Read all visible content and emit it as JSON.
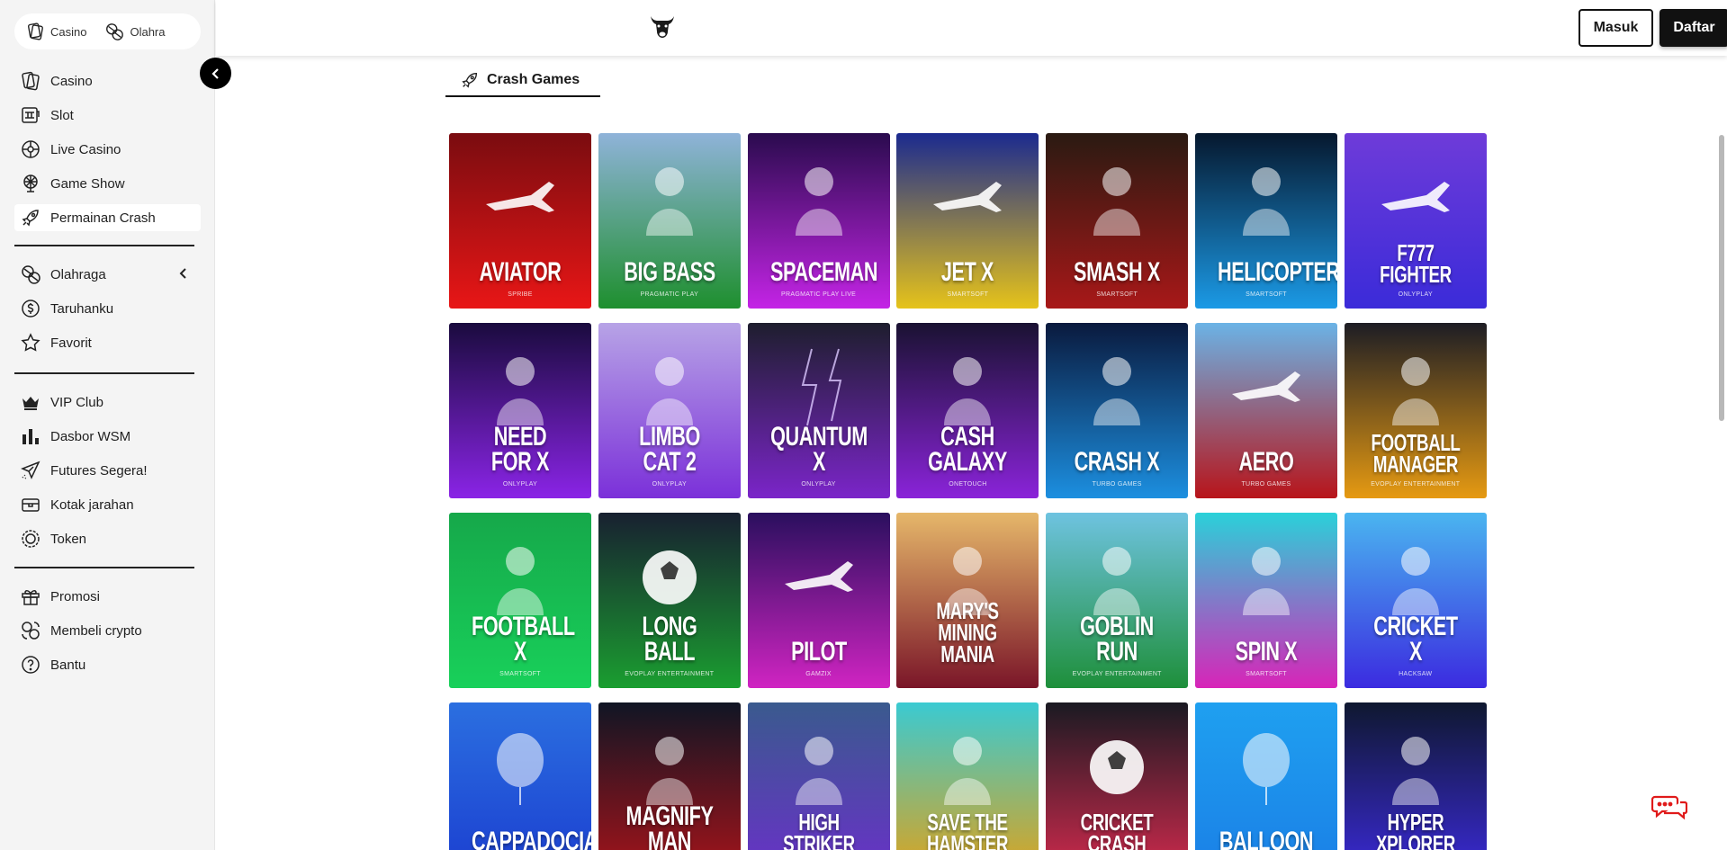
{
  "sidebar": {
    "switch": {
      "casino": "Casino",
      "sports": "Olahra"
    },
    "group1": [
      {
        "label": "Casino",
        "icon": "cards-icon"
      },
      {
        "label": "Slot",
        "icon": "slot-machine-icon"
      },
      {
        "label": "Live Casino",
        "icon": "roulette-icon"
      },
      {
        "label": "Game Show",
        "icon": "wheel-icon"
      },
      {
        "label": "Permainan Crash",
        "icon": "rocket-icon"
      }
    ],
    "group2": [
      {
        "label": "Olahraga",
        "icon": "balls-icon"
      },
      {
        "label": "Taruhanku",
        "icon": "coin-icon"
      },
      {
        "label": "Favorit",
        "icon": "star-icon"
      }
    ],
    "group3": [
      {
        "label": "VIP Club",
        "icon": "crown-icon"
      },
      {
        "label": "Dasbor WSM",
        "icon": "bar-chart-icon"
      },
      {
        "label": "Futures Segera!",
        "icon": "paper-plane-icon"
      },
      {
        "label": "Kotak jarahan",
        "icon": "chest-icon"
      },
      {
        "label": "Token",
        "icon": "token-icon"
      }
    ],
    "group4": [
      {
        "label": "Promosi",
        "icon": "gift-icon"
      },
      {
        "label": "Membeli crypto",
        "icon": "crypto-icon"
      },
      {
        "label": "Bantu",
        "icon": "help-icon"
      }
    ]
  },
  "header": {
    "login": "Masuk",
    "register": "Daftar"
  },
  "section": {
    "title": "Crash Games"
  },
  "games": [
    {
      "title": "AVIATOR",
      "provider": "SPRIBE",
      "colors": [
        "#7a0c10",
        "#e81616"
      ]
    },
    {
      "title": "BIG BASS",
      "provider": "PRAGMATIC PLAY",
      "colors": [
        "#8fb3d9",
        "#1e8f2e"
      ]
    },
    {
      "title": "SPACEMAN",
      "provider": "PRAGMATIC PLAY LIVE",
      "colors": [
        "#2a0b4e",
        "#c424e6"
      ]
    },
    {
      "title": "JET X",
      "provider": "SMARTSOFT",
      "colors": [
        "#1b2a8f",
        "#e6c31a"
      ]
    },
    {
      "title": "SMASH X",
      "provider": "SMARTSOFT",
      "colors": [
        "#2a1a12",
        "#a81818"
      ]
    },
    {
      "title": "HELICOPTERX",
      "provider": "SMARTSOFT",
      "colors": [
        "#06182e",
        "#1b9ae6"
      ]
    },
    {
      "title": "F777 FIGHTER",
      "provider": "ONLYPLAY",
      "colors": [
        "#6e3bd9",
        "#3b2bd9"
      ]
    },
    {
      "title": "NEED FOR X",
      "provider": "ONLYPLAY",
      "colors": [
        "#1a0b3e",
        "#8a24e6"
      ]
    },
    {
      "title": "LIMBO CAT 2",
      "provider": "ONLYPLAY",
      "colors": [
        "#b7a3e6",
        "#7b30d9"
      ]
    },
    {
      "title": "QUANTUM X",
      "provider": "ONLYPLAY",
      "colors": [
        "#1e1e2e",
        "#7b25c9"
      ]
    },
    {
      "title": "CASH GALAXY",
      "provider": "ONETOUCH",
      "colors": [
        "#1a1232",
        "#8a23d9"
      ]
    },
    {
      "title": "CRASH X",
      "provider": "TURBO GAMES",
      "colors": [
        "#0a1a3e",
        "#1c8fe0"
      ]
    },
    {
      "title": "AERO",
      "provider": "TURBO GAMES",
      "colors": [
        "#6bb3e6",
        "#b8141a"
      ]
    },
    {
      "title": "FOOTBALL MANAGER",
      "provider": "EVOPLAY ENTERTAINMENT",
      "colors": [
        "#1d1d24",
        "#e69a12"
      ]
    },
    {
      "title": "FOOTBALL X",
      "provider": "SMARTSOFT",
      "colors": [
        "#16a84a",
        "#18d05a"
      ]
    },
    {
      "title": "LONG BALL",
      "provider": "EVOPLAY ENTERTAINMENT",
      "colors": [
        "#182030",
        "#1a9e30"
      ]
    },
    {
      "title": "PILOT",
      "provider": "GAMZIX",
      "colors": [
        "#2a0f5e",
        "#d024c2"
      ]
    },
    {
      "title": "MARY'S MINING MANIA",
      "provider": "",
      "colors": [
        "#e6b76a",
        "#7a1528"
      ]
    },
    {
      "title": "GOBLIN RUN",
      "provider": "EVOPLAY ENTERTAINMENT",
      "colors": [
        "#6ec3e0",
        "#1e8f3a"
      ]
    },
    {
      "title": "SPIN X",
      "provider": "SMARTSOFT",
      "colors": [
        "#2ad1d9",
        "#d824b8"
      ]
    },
    {
      "title": "CRICKET X",
      "provider": "HACKSAW",
      "colors": [
        "#4ab5f0",
        "#3b2be0"
      ]
    },
    {
      "title": "CAPPADOCIA",
      "provider": "",
      "colors": [
        "#2b6fe0",
        "#1b3ed0"
      ]
    },
    {
      "title": "MAGNIFY MAN",
      "provider": "",
      "colors": [
        "#101524",
        "#a8141a"
      ]
    },
    {
      "title": "HIGH STRIKER",
      "provider": "",
      "colors": [
        "#3a5a8e",
        "#6a30c9"
      ]
    },
    {
      "title": "SAVE THE HAMSTER",
      "provider": "",
      "colors": [
        "#3acad2",
        "#e0a21a"
      ]
    },
    {
      "title": "CRICKET CRASH",
      "provider": "",
      "colors": [
        "#1a1a22",
        "#d42a4e"
      ]
    },
    {
      "title": "BALLOON",
      "provider": "",
      "colors": [
        "#1fa0f0",
        "#1a7fe6"
      ]
    },
    {
      "title": "HYPER XPLORER",
      "provider": "",
      "colors": [
        "#0f1830",
        "#3b2ad9"
      ]
    }
  ]
}
